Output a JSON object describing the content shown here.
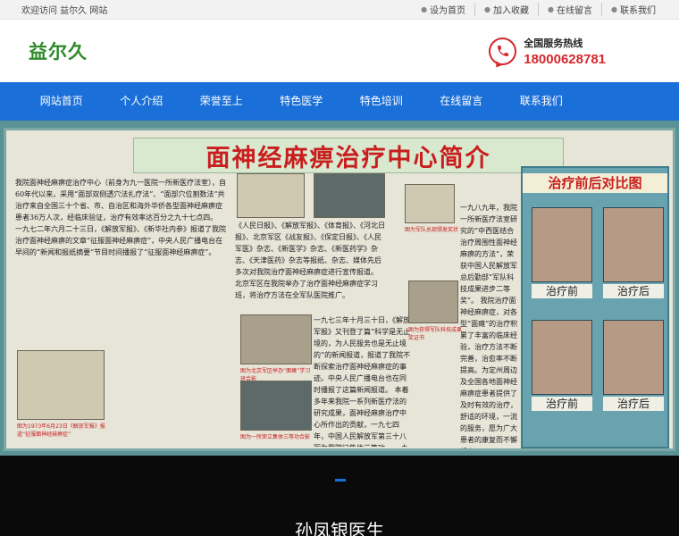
{
  "topbar": {
    "welcome": "欢迎访问 益尔久 网站",
    "links": [
      "设为首页",
      "加入收藏",
      "在线留言",
      "联系我们"
    ]
  },
  "header": {
    "logo": "益尔久",
    "hotline_label": "全国服务热线",
    "hotline_number": "18000628781",
    "icons": {
      "phone": "phone-chat-icon"
    }
  },
  "nav": {
    "items": [
      "网站首页",
      "个人介绍",
      "荣誉至上",
      "特色医学",
      "特色培训",
      "在线留言",
      "联系我们"
    ]
  },
  "banner": {
    "title": "面神经麻痹治疗中心简介",
    "col1": "我院面神经麻痹症治疗中心（前身为九一医院一所新医疗法室），自60年代以来，采用“面部双侧透穴法扎疗法”、“面部穴位割数法”共治疗来自全国三十个省、市、自治区和海外华侨各型面神经麻痹症患者36万人次，经临床验证，治疗有效率达百分之九十七点四。 一九七二年六月二十三日，《解放军报》、《新华社内参》报道了我院治疗面神经麻痹的文章“征服面神经麻痹症”，中央人民广播电台在早间的“新闻和报纸摘要”节目时间播报了“征服面神经麻痹症”。",
    "col2": "《人民日报》、《解放军报》、《体育报》、《河北日报》、北京军区《战友报》、《保定日报》、《人民军医》杂志、《新医学》杂志、《新医药学》杂志、《天津医药》杂志等报纸、杂志、媒体先后多次对我院治疗面神经麻痹症进行宣传报道。 北京军区在我院举办了治疗面神经麻痹症学习班，将治疗方法在全军队医院推广。",
    "col3": "一九七三年十月三十日，《解放军报》又刊登了篇“科学是无止境的，为人民服务也是无止境的”的新闻报道，报道了我院不断探索治疗面神经麻痹症的事迹。中央人民广播电台也在同时播报了这篇新闻报道。 本着多年来我院一系列新医疗法的研究成果，面神经麻痹治疗中心所作出的贡献，一九七四年，中国人民解放军第三十八军为我院记集体三等功。 一九七八年，我院受到中国人民解放军北京军区奖励。",
    "col4": "一九八九年，我院一所新医疗法室研究的“中西医结合治疗周围性面神经麻痹的方法”，荣获中国人民解放军总后勤部“军队科技成果进步二等奖”。 我院治疗面神经麻痹症，对各型“面瘫”的治疗积累了丰富的临床经验，治疗方法不断完善，治愈率不断提高。为定州周边及全国各地面神经麻痹症患者提供了及时有效的治疗，舒适的环境，一流的服务，愿为广大患者的康复而不懈努力。",
    "captions": [
      "图为军队总部颁发奖状",
      "图为北京军区举办“面瘫”学习班合影",
      "图为一所荣立集体三等功合影",
      "图为获得军队科技成果奖证书",
      "图为1973年6月23日《解放军报》报道“征服面神经麻痹症”"
    ],
    "compare_title": "治疗前后对比图",
    "before_label": "治疗前",
    "after_label": "治疗后"
  },
  "section": {
    "doctor_name": "孙凤银医生"
  }
}
